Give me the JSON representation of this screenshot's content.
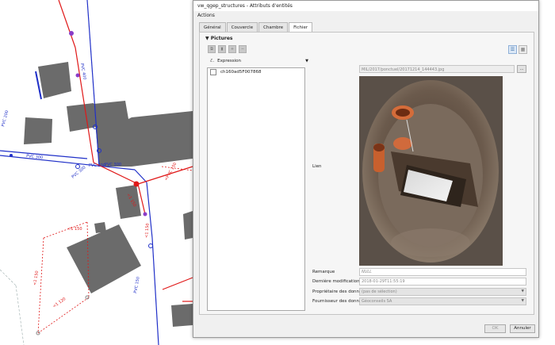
{
  "window": {
    "title": "vw_qgep_structures - Attributs d'entités"
  },
  "menu": {
    "actions": "Actions"
  },
  "tabs": [
    {
      "label": "Général"
    },
    {
      "label": "Couvercle"
    },
    {
      "label": "Chambre"
    },
    {
      "label": "Fichier"
    }
  ],
  "pictures": {
    "section_title": "Pictures",
    "expression_label": "Expression",
    "items": [
      "ch160ad5F007868"
    ]
  },
  "file": {
    "path": "MIL/2017/ponctuel/20171214_144443.jpg",
    "browse_label": "...",
    "link_label": "Lien"
  },
  "fields": {
    "remarque_label": "Remarque",
    "remarque_value": "NULL",
    "derniere_label": "Dernière modification",
    "derniere_value": "2018-01-29T11:55:19",
    "proprietaire_label": "Propriétaire des données",
    "proprietaire_value": "(pas de sélection)",
    "fournisseur_label": "Fournisseur des donnés",
    "fournisseur_value": "Géoconseils SA"
  },
  "buttons": {
    "ok": "OK",
    "cancel": "Annuler"
  },
  "map": {
    "labels": [
      "PVC 300",
      "PVC 300",
      "PVC 300",
      "PVC 300",
      "PVC 200",
      "PVC 400",
      "PVC 150",
      "<1 150",
      "<1 150",
      "<1 120",
      "<1 150",
      "<1 150",
      "<PVC 150"
    ]
  },
  "colors": {
    "accent": "#3a6ea8",
    "pipe_blue": "#2030c8",
    "pipe_red": "#e01818",
    "building": "#6b6b6b"
  }
}
